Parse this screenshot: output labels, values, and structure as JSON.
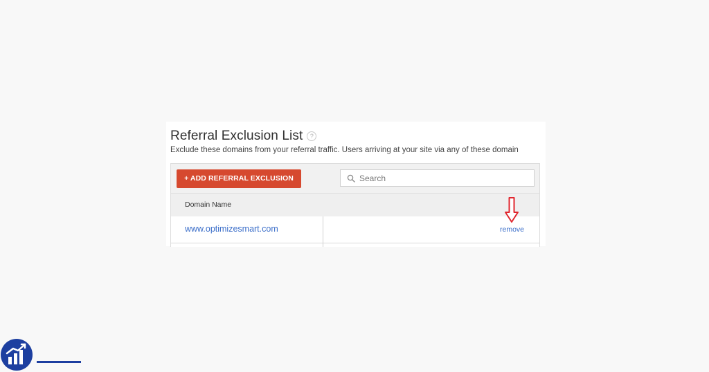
{
  "panel": {
    "title": "Referral Exclusion List",
    "help_icon_glyph": "?",
    "subtitle": "Exclude these domains from your referral traffic. Users arriving at your site via any of these domain"
  },
  "toolbar": {
    "add_button_label": "+ ADD REFERRAL EXCLUSION",
    "search_placeholder": "Search"
  },
  "table": {
    "column_headers": [
      "Domain Name"
    ],
    "rows": [
      {
        "domain": "www.optimizesmart.com",
        "action_label": "remove"
      }
    ]
  },
  "colors": {
    "accent_button": "#d6492f",
    "link": "#3b6ec9",
    "annotation_arrow": "#e0262e",
    "logo_blue": "#1d3fa0"
  },
  "icons": {
    "help": "question-circle-icon",
    "search": "magnifier-icon",
    "annotation": "down-arrow-icon",
    "logo": "bar-chart-growth-icon"
  }
}
